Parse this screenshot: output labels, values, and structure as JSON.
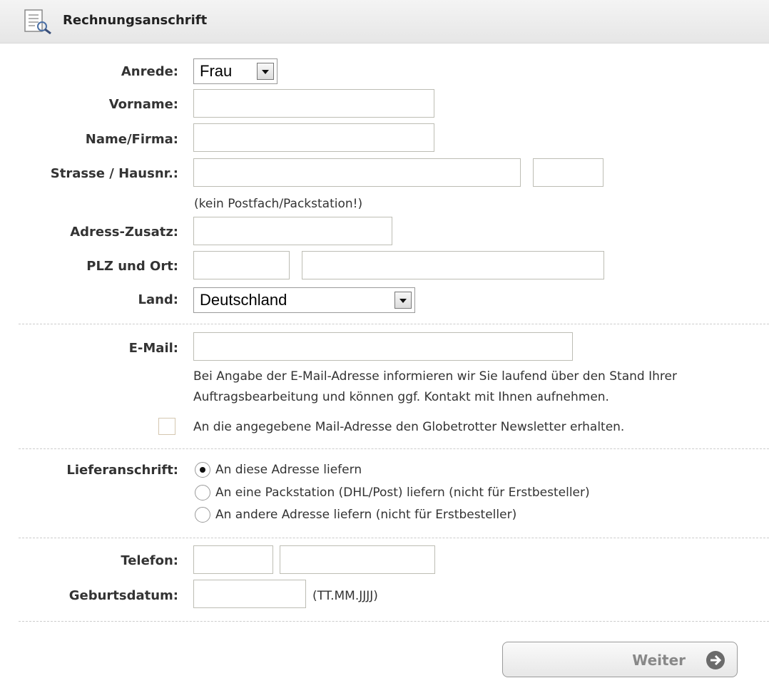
{
  "header": {
    "title": "Rechnungsanschrift",
    "icon": "document-search-icon"
  },
  "form": {
    "anrede": {
      "label": "Anrede:",
      "value": "Frau"
    },
    "vorname": {
      "label": "Vorname:",
      "value": ""
    },
    "name": {
      "label": "Name/Firma:",
      "value": ""
    },
    "strasse": {
      "label": "Strasse / Hausnr.:",
      "street_value": "",
      "number_value": "",
      "hint": "(kein Postfach/Packstation!)"
    },
    "zusatz": {
      "label": "Adress-Zusatz:",
      "value": ""
    },
    "plz_ort": {
      "label": "PLZ und Ort:",
      "plz_value": "",
      "ort_value": ""
    },
    "land": {
      "label": "Land:",
      "value": "Deutschland"
    },
    "email": {
      "label": "E-Mail:",
      "value": "",
      "info_line1": "Bei Angabe der E-Mail-Adresse informieren wir Sie laufend über den Stand Ihrer",
      "info_line2": "Auftragsbearbeitung und können ggf. Kontakt mit Ihnen aufnehmen."
    },
    "newsletter": {
      "label": "An die angegebene Mail-Adresse den Globetrotter Newsletter erhalten.",
      "checked": false
    },
    "lieferanschrift": {
      "label": "Lieferanschrift:",
      "options": [
        {
          "label": "An diese Adresse liefern",
          "selected": true
        },
        {
          "label": "An eine Packstation (DHL/Post) liefern (nicht für Erstbesteller)",
          "selected": false
        },
        {
          "label": "An andere Adresse liefern (nicht für Erstbesteller)",
          "selected": false
        }
      ]
    },
    "telefon": {
      "label": "Telefon:",
      "prefix_value": "",
      "number_value": ""
    },
    "geburtsdatum": {
      "label": "Geburtsdatum:",
      "value": "",
      "hint": "(TT.MM.JJJJ)"
    }
  },
  "actions": {
    "continue_label": "Weiter",
    "continue_icon": "arrow-right-circle-icon"
  }
}
